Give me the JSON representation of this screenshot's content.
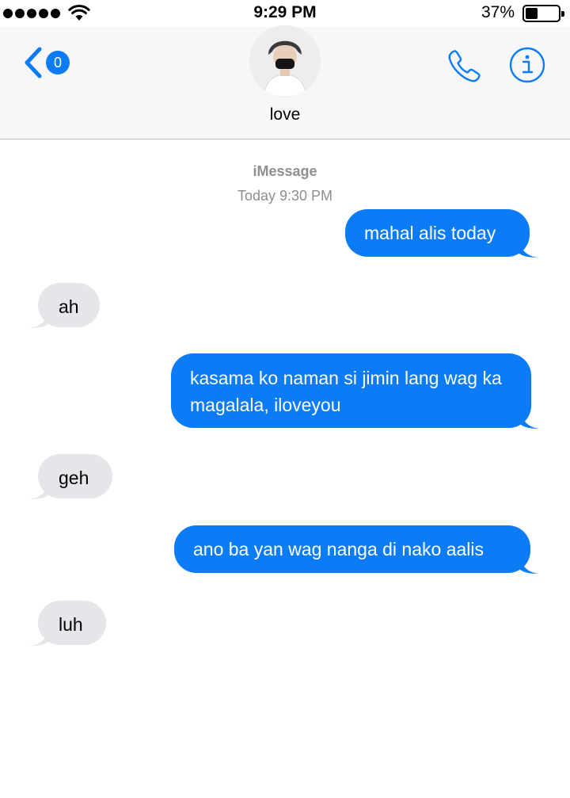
{
  "status_bar": {
    "signal_bars": 5,
    "time": "9:29 PM",
    "battery_percent": "37%",
    "battery_level": 0.37
  },
  "header": {
    "unread_count": "0",
    "contact_name": "love",
    "accent_color": "#0b7cf5"
  },
  "conversation": {
    "service_label": "iMessage",
    "timestamp": "Today 9:30 PM",
    "messages": [
      {
        "direction": "sent",
        "text": "mahal alis today"
      },
      {
        "direction": "received",
        "text": "ah"
      },
      {
        "direction": "sent",
        "text": "kasama ko naman si jimin lang wag ka magalala, iloveyou"
      },
      {
        "direction": "received",
        "text": "geh"
      },
      {
        "direction": "sent",
        "text": "ano ba yan wag nanga di nako aalis"
      },
      {
        "direction": "received",
        "text": "luh"
      }
    ]
  },
  "icons": {
    "back": "chevron-left-icon",
    "call": "phone-icon",
    "info": "info-icon",
    "wifi": "wifi-icon",
    "battery": "battery-icon"
  },
  "colors": {
    "sent_bubble": "#0b7cf5",
    "received_bubble": "#e5e5ea",
    "meta_text": "#8e8e93"
  }
}
